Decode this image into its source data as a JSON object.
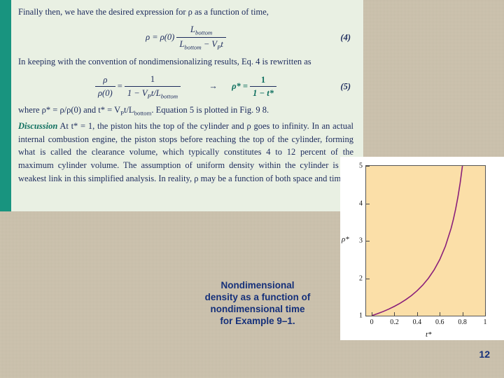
{
  "slide": {
    "page_number": "12",
    "background_color": "#cdc3ad"
  },
  "text_panel": {
    "accent_color": "#18947f",
    "background_color": "#e9f0e3",
    "text_color": "#1c2a5c",
    "line_1": "Finally then, we have the desired expression for ρ as a function of time,",
    "equation_4": {
      "lhs": "ρ =",
      "rho0": "ρ(0)",
      "numerator": "L",
      "numerator_sub": "bottom",
      "denominator": "L",
      "denominator_sub": "bottom",
      "denominator_rest": " − V",
      "denominator_rest_sub": "P",
      "denominator_tail": "t",
      "number": "(4)"
    },
    "line_2": "In keeping with the convention of nondimensionalizing results, Eq. 4 is rewritten as",
    "equation_5": {
      "lhs_num": "ρ",
      "lhs_den": "ρ(0)",
      "eq": "=",
      "rhs_num": "1",
      "rhs_den": "1 − V",
      "rhs_den_sub": "P",
      "rhs_den_rest": "t/L",
      "rhs_den_sub2": "bottom",
      "arrow": "→",
      "starred_lhs": "ρ* =",
      "starred_num": "1",
      "starred_den": "1 − t*",
      "number": "(5)"
    },
    "line_3": "where ρ* = ρ/ρ(0) and t* = V",
    "line_3b": "t/L",
    "line_3c": ". Equation 5 is plotted in Fig. 9 8.",
    "discussion_label": "Discussion",
    "discussion_text": "At t* = 1, the piston hits the top of the cylinder and ρ goes to infinity. In an actual internal combustion engine, the piston stops before reaching the top of the cylinder, forming what is called the clearance volume, which typically constitutes 4 to 12 percent of the maximum cylinder volume. The assumption of uniform density within the cylinder is the weakest link in this simplified analysis. In reality, ρ may be a function of both space and time."
  },
  "caption": {
    "text": "Nondimensional density as a function of nondimensional time for Example 9–1.",
    "color": "#15307a"
  },
  "chart_data": {
    "type": "line",
    "title": "",
    "xlabel": "t*",
    "ylabel": "ρ*",
    "xlim": [
      -0.05,
      1.0
    ],
    "ylim": [
      1,
      5
    ],
    "xticks": [
      "0",
      "0.2",
      "0.4",
      "0.6",
      "0.8",
      "1"
    ],
    "xtick_values": [
      0,
      0.2,
      0.4,
      0.6,
      0.8,
      1.0
    ],
    "yticks": [
      "1",
      "2",
      "3",
      "4",
      "5"
    ],
    "ytick_values": [
      1,
      2,
      3,
      4,
      5
    ],
    "grid": false,
    "plot_background": "#fbdfa8",
    "line_color": "#8a1f7a",
    "series": [
      {
        "name": "ρ* = 1/(1 − t*)",
        "x": [
          0.0,
          0.05,
          0.1,
          0.15,
          0.2,
          0.25,
          0.3,
          0.35,
          0.4,
          0.45,
          0.5,
          0.55,
          0.6,
          0.65,
          0.7,
          0.72,
          0.74,
          0.76,
          0.78,
          0.8
        ],
        "y": [
          1.0,
          1.053,
          1.111,
          1.176,
          1.25,
          1.333,
          1.429,
          1.538,
          1.667,
          1.818,
          2.0,
          2.222,
          2.5,
          2.857,
          3.333,
          3.571,
          3.846,
          4.167,
          4.545,
          5.0
        ]
      }
    ]
  }
}
